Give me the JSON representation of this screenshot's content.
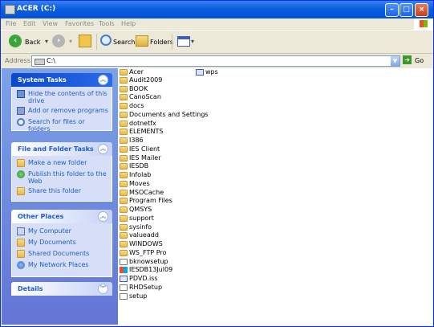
{
  "window": {
    "title": "ACER (C:)"
  },
  "menu": [
    "File",
    "Edit",
    "View",
    "Favorites",
    "Tools",
    "Help"
  ],
  "toolbar": {
    "back_label": "Back",
    "search_label": "Search",
    "folders_label": "Folders"
  },
  "address": {
    "label": "Address",
    "value": "C:\\",
    "go_label": "Go"
  },
  "task_pane": {
    "system_tasks": {
      "title": "System Tasks",
      "items": [
        "Hide the contents of this drive",
        "Add or remove programs",
        "Search for files or folders"
      ]
    },
    "file_folder_tasks": {
      "title": "File and Folder Tasks",
      "items": [
        "Make a new folder",
        "Publish this folder to the Web",
        "Share this folder"
      ]
    },
    "other_places": {
      "title": "Other Places",
      "items": [
        "My Computer",
        "My Documents",
        "Shared Documents",
        "My Network Places"
      ]
    },
    "details": {
      "title": "Details"
    }
  },
  "files": {
    "col1": [
      "Acer",
      "Audit2009",
      "BOOK",
      "CanoScan",
      "docs",
      "Documents and Settings",
      "dotnetfx",
      "ELEMENTS",
      "I386",
      "IES Client",
      "IES Mailer",
      "IESDB",
      "Infolab",
      "Moves",
      "MSOCache",
      "Program Files",
      "QMSYS",
      "support",
      "sysinfo",
      "valueadd",
      "WINDOWS",
      "WS_FTP Pro",
      "bknowsetup",
      "IESDB13Jul09",
      "PDVD.iss",
      "RHDSetup",
      "setup"
    ],
    "col2": [
      "wps"
    ]
  }
}
